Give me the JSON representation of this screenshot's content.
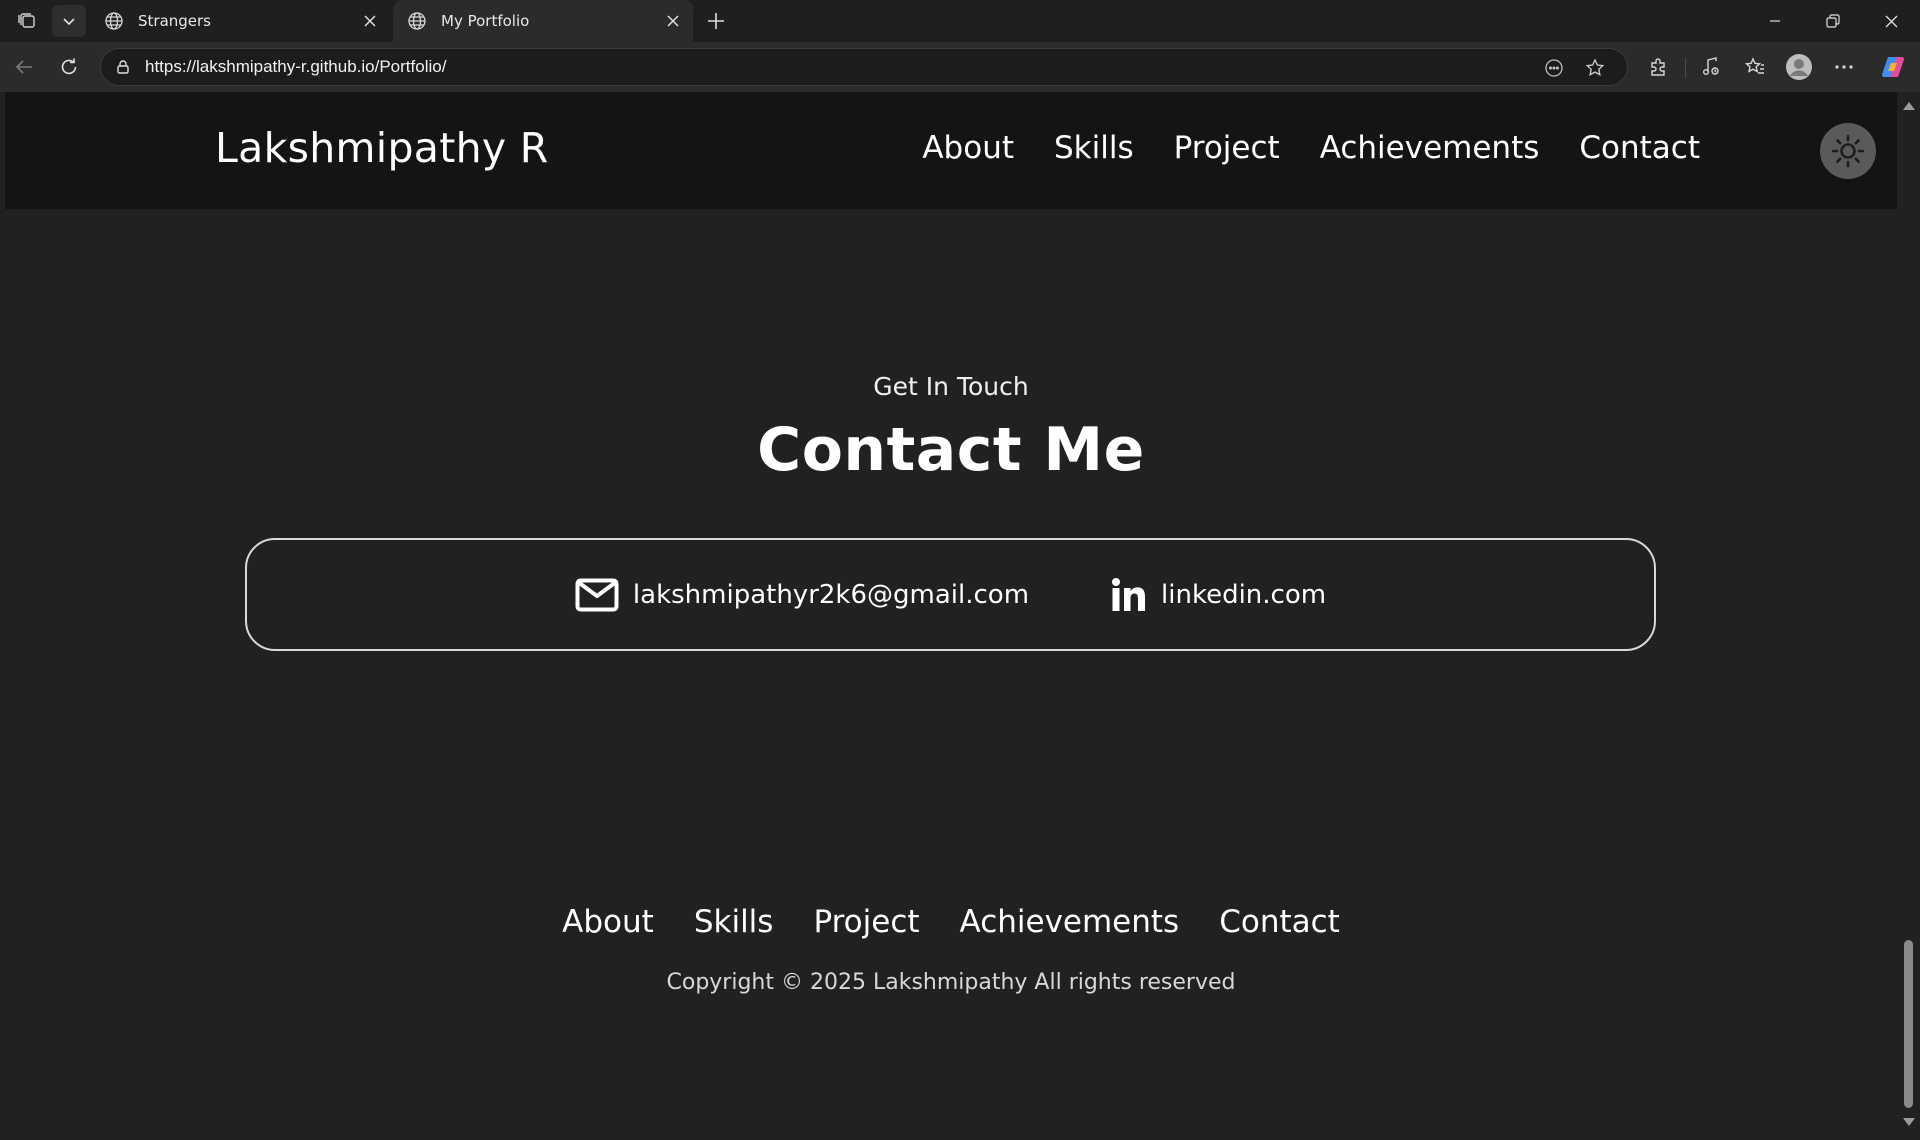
{
  "browser": {
    "tabs": [
      {
        "title": "Strangers",
        "active": false
      },
      {
        "title": "My Portfolio",
        "active": true
      }
    ],
    "url": "https://lakshmipathy-r.github.io/Portfolio/"
  },
  "site": {
    "brand": "Lakshmipathy R",
    "nav": [
      "About",
      "Skills",
      "Project",
      "Achievements",
      "Contact"
    ],
    "contact": {
      "eyebrow": "Get In Touch",
      "heading": "Contact Me",
      "email": "lakshmipathyr2k6@gmail.com",
      "linkedin": "linkedin.com"
    },
    "footer": {
      "links": [
        "About",
        "Skills",
        "Project",
        "Achievements",
        "Contact"
      ],
      "copyright": "Copyright © 2025 Lakshmipathy All rights reserved"
    }
  },
  "icons": {
    "tab_actions": "workspaces-icon",
    "theme_toggle": "sun-icon",
    "email": "mail-icon",
    "linkedin": "linkedin-icon"
  },
  "colors": {
    "header_bg": "#141414",
    "page_bg": "#212121",
    "text": "#ffffff",
    "toggle_bg": "#5a5a5a"
  }
}
